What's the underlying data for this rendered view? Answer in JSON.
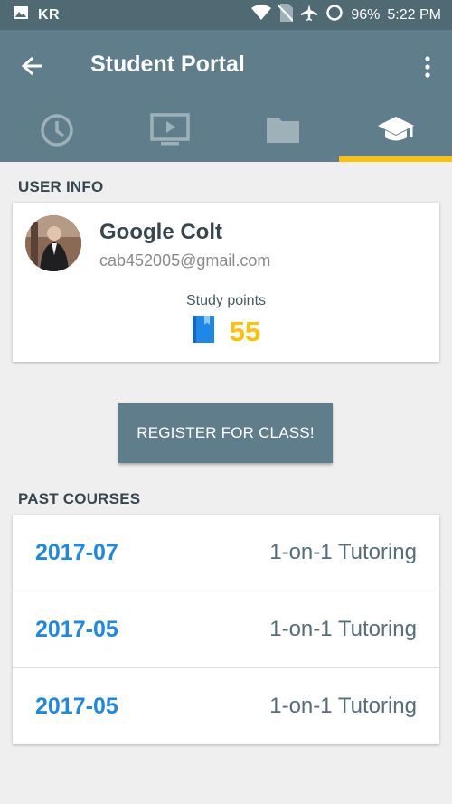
{
  "status_bar": {
    "carrier": "KR",
    "battery": "96%",
    "time": "5:22 PM"
  },
  "app_bar": {
    "title": "Student Portal"
  },
  "tabs": [
    {
      "icon": "clock-icon",
      "active": false
    },
    {
      "icon": "video-icon",
      "active": false
    },
    {
      "icon": "folder-icon",
      "active": false
    },
    {
      "icon": "graduation-cap-icon",
      "active": true
    }
  ],
  "user_info": {
    "section_label": "USER INFO",
    "name": "Google Colt",
    "email": "cab452005@gmail.com",
    "points_label": "Study points",
    "points": "55"
  },
  "register_button": {
    "label": "REGISTER FOR CLASS!"
  },
  "past_courses": {
    "section_label": "PAST COURSES",
    "items": [
      {
        "date": "2017-07",
        "type": "1-on-1 Tutoring"
      },
      {
        "date": "2017-05",
        "type": "1-on-1 Tutoring"
      },
      {
        "date": "2017-05",
        "type": "1-on-1 Tutoring"
      }
    ]
  },
  "colors": {
    "primary": "#607d8b",
    "status_bar": "#4f6a73",
    "accent": "#ffc107",
    "link": "#1e88e5"
  }
}
